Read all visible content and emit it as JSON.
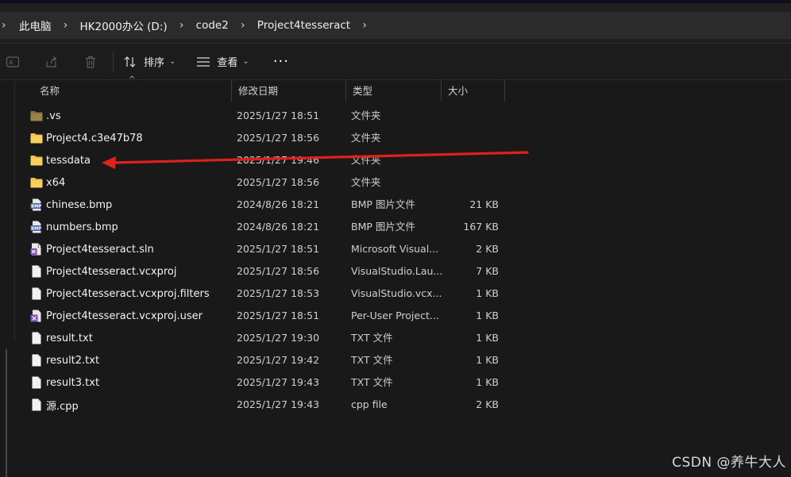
{
  "breadcrumbs": [
    "此电脑",
    "HK2000办公 (D:)",
    "code2",
    "Project4tesseract"
  ],
  "toolbar": {
    "sort_label": "排序",
    "view_label": "查看",
    "more_label": "···"
  },
  "columns": {
    "name": "名称",
    "date": "修改日期",
    "type": "类型",
    "size": "大小"
  },
  "files": [
    {
      "name": ".vs",
      "date": "2025/1/27 18:51",
      "type": "文件夹",
      "size": "",
      "icon": "folder-dim"
    },
    {
      "name": "Project4.c3e47b78",
      "date": "2025/1/27 18:56",
      "type": "文件夹",
      "size": "",
      "icon": "folder"
    },
    {
      "name": "tessdata",
      "date": "2025/1/27 19:46",
      "type": "文件夹",
      "size": "",
      "icon": "folder"
    },
    {
      "name": "x64",
      "date": "2025/1/27 18:56",
      "type": "文件夹",
      "size": "",
      "icon": "folder"
    },
    {
      "name": "chinese.bmp",
      "date": "2024/8/26 18:21",
      "type": "BMP 图片文件",
      "size": "21 KB",
      "icon": "bmp"
    },
    {
      "name": "numbers.bmp",
      "date": "2024/8/26 18:21",
      "type": "BMP 图片文件",
      "size": "167 KB",
      "icon": "bmp"
    },
    {
      "name": "Project4tesseract.sln",
      "date": "2025/1/27 18:51",
      "type": "Microsoft Visual...",
      "size": "2 KB",
      "icon": "sln"
    },
    {
      "name": "Project4tesseract.vcxproj",
      "date": "2025/1/27 18:56",
      "type": "VisualStudio.Lau...",
      "size": "7 KB",
      "icon": "file"
    },
    {
      "name": "Project4tesseract.vcxproj.filters",
      "date": "2025/1/27 18:53",
      "type": "VisualStudio.vcx...",
      "size": "1 KB",
      "icon": "file"
    },
    {
      "name": "Project4tesseract.vcxproj.user",
      "date": "2025/1/27 18:51",
      "type": "Per-User Project...",
      "size": "1 KB",
      "icon": "user"
    },
    {
      "name": "result.txt",
      "date": "2025/1/27 19:30",
      "type": "TXT 文件",
      "size": "1 KB",
      "icon": "file"
    },
    {
      "name": "result2.txt",
      "date": "2025/1/27 19:42",
      "type": "TXT 文件",
      "size": "1 KB",
      "icon": "file"
    },
    {
      "name": "result3.txt",
      "date": "2025/1/27 19:43",
      "type": "TXT 文件",
      "size": "1 KB",
      "icon": "file"
    },
    {
      "name": "源.cpp",
      "date": "2025/1/27 19:43",
      "type": "cpp file",
      "size": "2 KB",
      "icon": "file"
    }
  ],
  "annotation_color": "#e0211b",
  "folder_color": "#f0bf4c",
  "watermark": "CSDN @养牛大人"
}
